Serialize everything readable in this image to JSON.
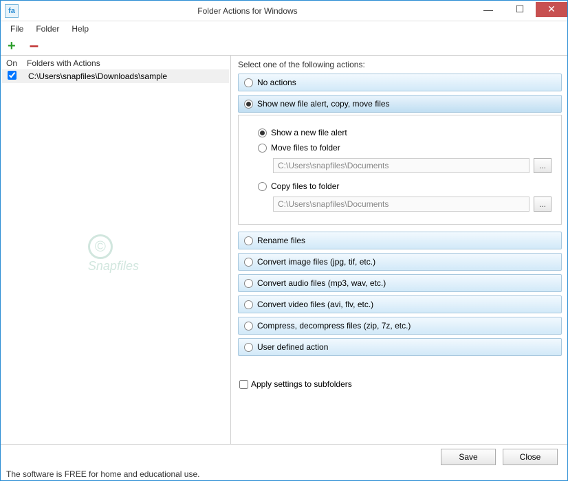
{
  "window": {
    "title": "Folder Actions for Windows",
    "app_icon_text": "fa"
  },
  "menu": {
    "file": "File",
    "folder": "Folder",
    "help": "Help"
  },
  "left": {
    "col_on": "On",
    "col_folders": "Folders with Actions",
    "folder_path": "C:\\Users\\snapfiles\\Downloads\\sample",
    "folder_checked": true
  },
  "right": {
    "heading": "Select one of the following actions:",
    "actions": {
      "no_actions": "No actions",
      "show_alert": "Show new file alert, copy, move files",
      "rename": "Rename files",
      "convert_image": "Convert image files (jpg, tif, etc.)",
      "convert_audio": "Convert audio files (mp3, wav, etc.)",
      "convert_video": "Convert video files (avi, flv, etc.)",
      "compress": "Compress, decompress files (zip, 7z, etc.)",
      "user_defined": "User defined action"
    },
    "sub": {
      "show_alert": "Show a new file alert",
      "move": "Move files to folder",
      "move_path": "C:\\Users\\snapfiles\\Documents",
      "copy": "Copy files to folder",
      "copy_path": "C:\\Users\\snapfiles\\Documents"
    },
    "apply_subfolders": "Apply settings to subfolders"
  },
  "buttons": {
    "save": "Save",
    "close": "Close",
    "browse": "..."
  },
  "status": "The software is FREE for home and educational use.",
  "watermark": "Snapfiles"
}
